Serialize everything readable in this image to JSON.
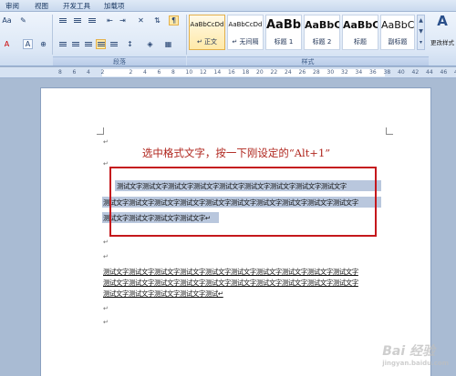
{
  "tabs": [
    "审阅",
    "视图",
    "开发工具",
    "加载项"
  ],
  "ribbon": {
    "groups": {
      "paragraph": "段落",
      "styles": "样式"
    },
    "styles": [
      {
        "sample": "AaBbCcDd",
        "name": "↵ 正文"
      },
      {
        "sample": "AaBbCcDd",
        "name": "↵ 无间隔"
      },
      {
        "sample": "AaBb",
        "name": "标题 1"
      },
      {
        "sample": "AaBbC",
        "name": "标题 2"
      },
      {
        "sample": "AaBbC",
        "name": "标题"
      },
      {
        "sample": "AaBbC",
        "name": "副标题"
      }
    ],
    "change_styles": "更改样式"
  },
  "ruler": {
    "numbers": [
      "8",
      "6",
      "4",
      "2",
      "",
      "2",
      "4",
      "6",
      "8",
      "10",
      "12",
      "14",
      "16",
      "18",
      "20",
      "22",
      "24",
      "26",
      "28",
      "30",
      "32",
      "34",
      "36",
      "38",
      "40",
      "42",
      "44",
      "46",
      "48"
    ]
  },
  "document": {
    "para_mark": "↵",
    "title": "选中格式文字，按一下刚设定的“Alt+1”",
    "selected_lines": [
      "测试文字测试文字测试文字测试文字测试文字测试文字测试文字测试文字测试文字",
      "测试文字测试文字测试文字测试文字测试文字测试文字测试文字测试文字测试文字测试文字",
      "测试文字测试文字测试文字测试文字↵"
    ],
    "formatted_lines": [
      "测试文字测试文字测试文字测试文字测试文字测试文字测试文字测试文字测试文字测试文字",
      "测试文字测试文字测试文字测试文字测试文字测试文字测试文字测试文字测试文字测试文字",
      "测试文字测试文字测试文字测试文字测试↵"
    ]
  },
  "watermark": {
    "brand": "Bai 经验",
    "url": "jingyan.baidu.com"
  },
  "colors": {
    "title_red": "#b0261e",
    "highlight_box": "#c5181c",
    "selection": "#b9c7dd"
  }
}
